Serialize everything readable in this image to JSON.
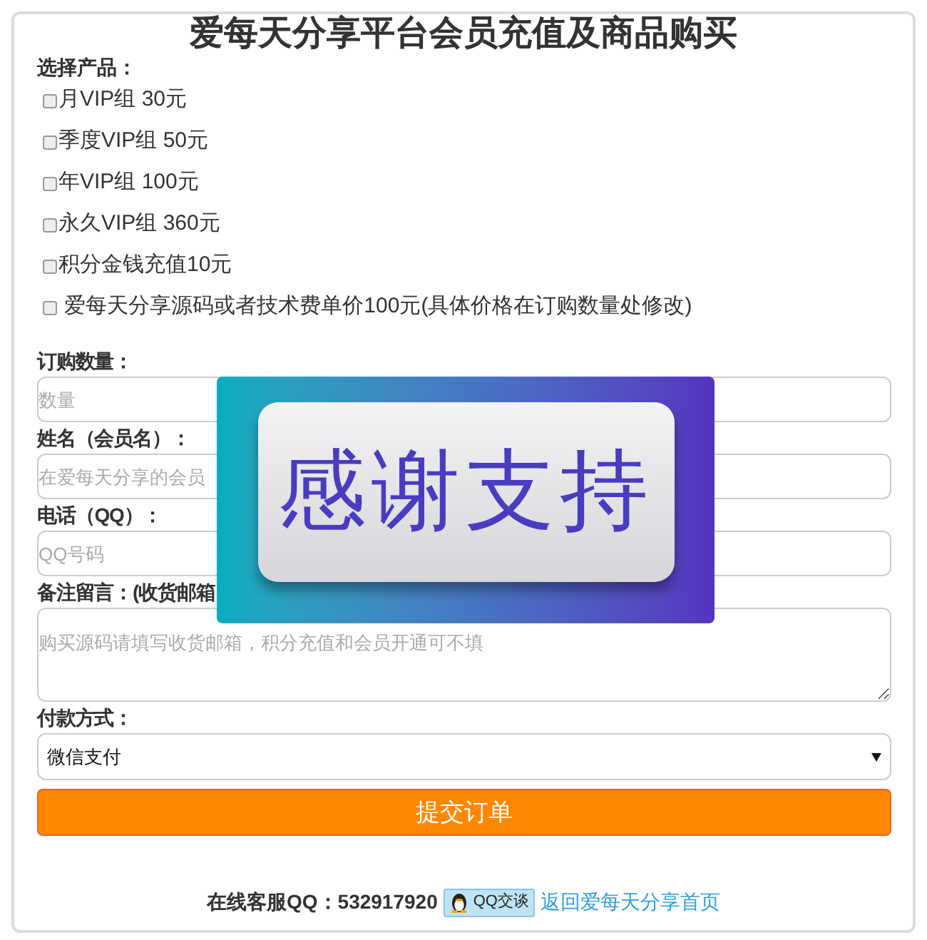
{
  "title": "爱每天分享平台会员充值及商品购买",
  "product_label": "选择产品：",
  "products": [
    {
      "label": "月VIP组 30元",
      "checked": false
    },
    {
      "label": "季度VIP组 50元",
      "checked": false
    },
    {
      "label": "年VIP组 100元",
      "checked": false
    },
    {
      "label": "永久VIP组 360元",
      "checked": false
    },
    {
      "label": "积分金钱充值10元",
      "checked": false
    },
    {
      "label": " 爱每天分享源码或者技术费单价100元(具体价格在订购数量处修改)",
      "checked": false
    }
  ],
  "fields": [
    {
      "kind": "input",
      "label": "订购数量：",
      "placeholder": "数量"
    },
    {
      "kind": "input",
      "label": "姓名（会员名）：",
      "placeholder": "在爱每天分享的会员"
    },
    {
      "kind": "input",
      "label": "电话（QQ）：",
      "placeholder": "QQ号码"
    },
    {
      "kind": "textarea",
      "label": "备注留言：(收货邮箱",
      "placeholder": "购买源码请填写收货邮箱，积分充值和会员开通可不填"
    },
    {
      "kind": "select",
      "label": "付款方式：",
      "value": "微信支付"
    }
  ],
  "submit": "提交订单",
  "overlay": {
    "text": "感谢支持"
  },
  "footer": {
    "service": "在线客服QQ：532917920",
    "qq_button": "QQ交谈",
    "home_link": "返回爱每天分享首页"
  }
}
